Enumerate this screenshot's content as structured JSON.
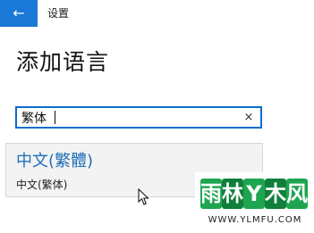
{
  "titlebar": {
    "back_icon": "back-arrow-icon",
    "back_glyph": "←",
    "title": "设置",
    "accent_color": "#1a78d6"
  },
  "main": {
    "page_title": "添加语言",
    "search": {
      "value": "繁体",
      "placeholder": "",
      "clear_icon": "close-icon",
      "clear_glyph": "×",
      "focus_color": "#0c6ccc"
    },
    "suggestions": [
      {
        "title": "中文(繁體)",
        "subtitle": "中文(繁体)"
      }
    ]
  },
  "watermark": {
    "logo_text": [
      "雨",
      "林",
      "Y",
      "木",
      "风"
    ],
    "url": "WWW.YLMFU.COM"
  }
}
